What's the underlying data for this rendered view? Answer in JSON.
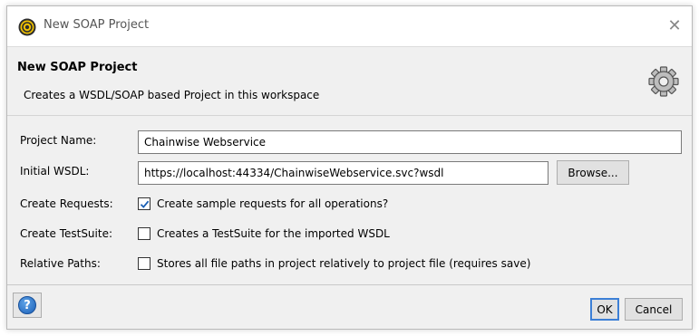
{
  "window": {
    "title": "New SOAP Project",
    "close_glyph": "✕"
  },
  "header": {
    "title": "New SOAP Project",
    "description": "Creates a WSDL/SOAP based Project in this workspace",
    "icon": "gear-icon"
  },
  "form": {
    "project_name": {
      "label": "Project Name:",
      "value": "Chainwise Webservice"
    },
    "initial_wsdl": {
      "label": "Initial WSDL:",
      "value": "https://localhost:44334/ChainwiseWebservice.svc?wsdl",
      "browse_label": "Browse..."
    },
    "create_requests": {
      "label": "Create Requests:",
      "text": "Create sample requests for all operations?",
      "checked": true
    },
    "create_testsuite": {
      "label": "Create TestSuite:",
      "text": "Creates a TestSuite for the imported WSDL",
      "checked": false
    },
    "relative_paths": {
      "label": "Relative Paths:",
      "text": "Stores all file paths in project relatively to project file (requires save)",
      "checked": false
    }
  },
  "footer": {
    "help_glyph": "?",
    "ok_label": "OK",
    "cancel_label": "Cancel"
  },
  "colors": {
    "panel_bg": "#f0f0f0",
    "help_blue": "#1b5fb7",
    "check_blue": "#1a5fb4"
  }
}
